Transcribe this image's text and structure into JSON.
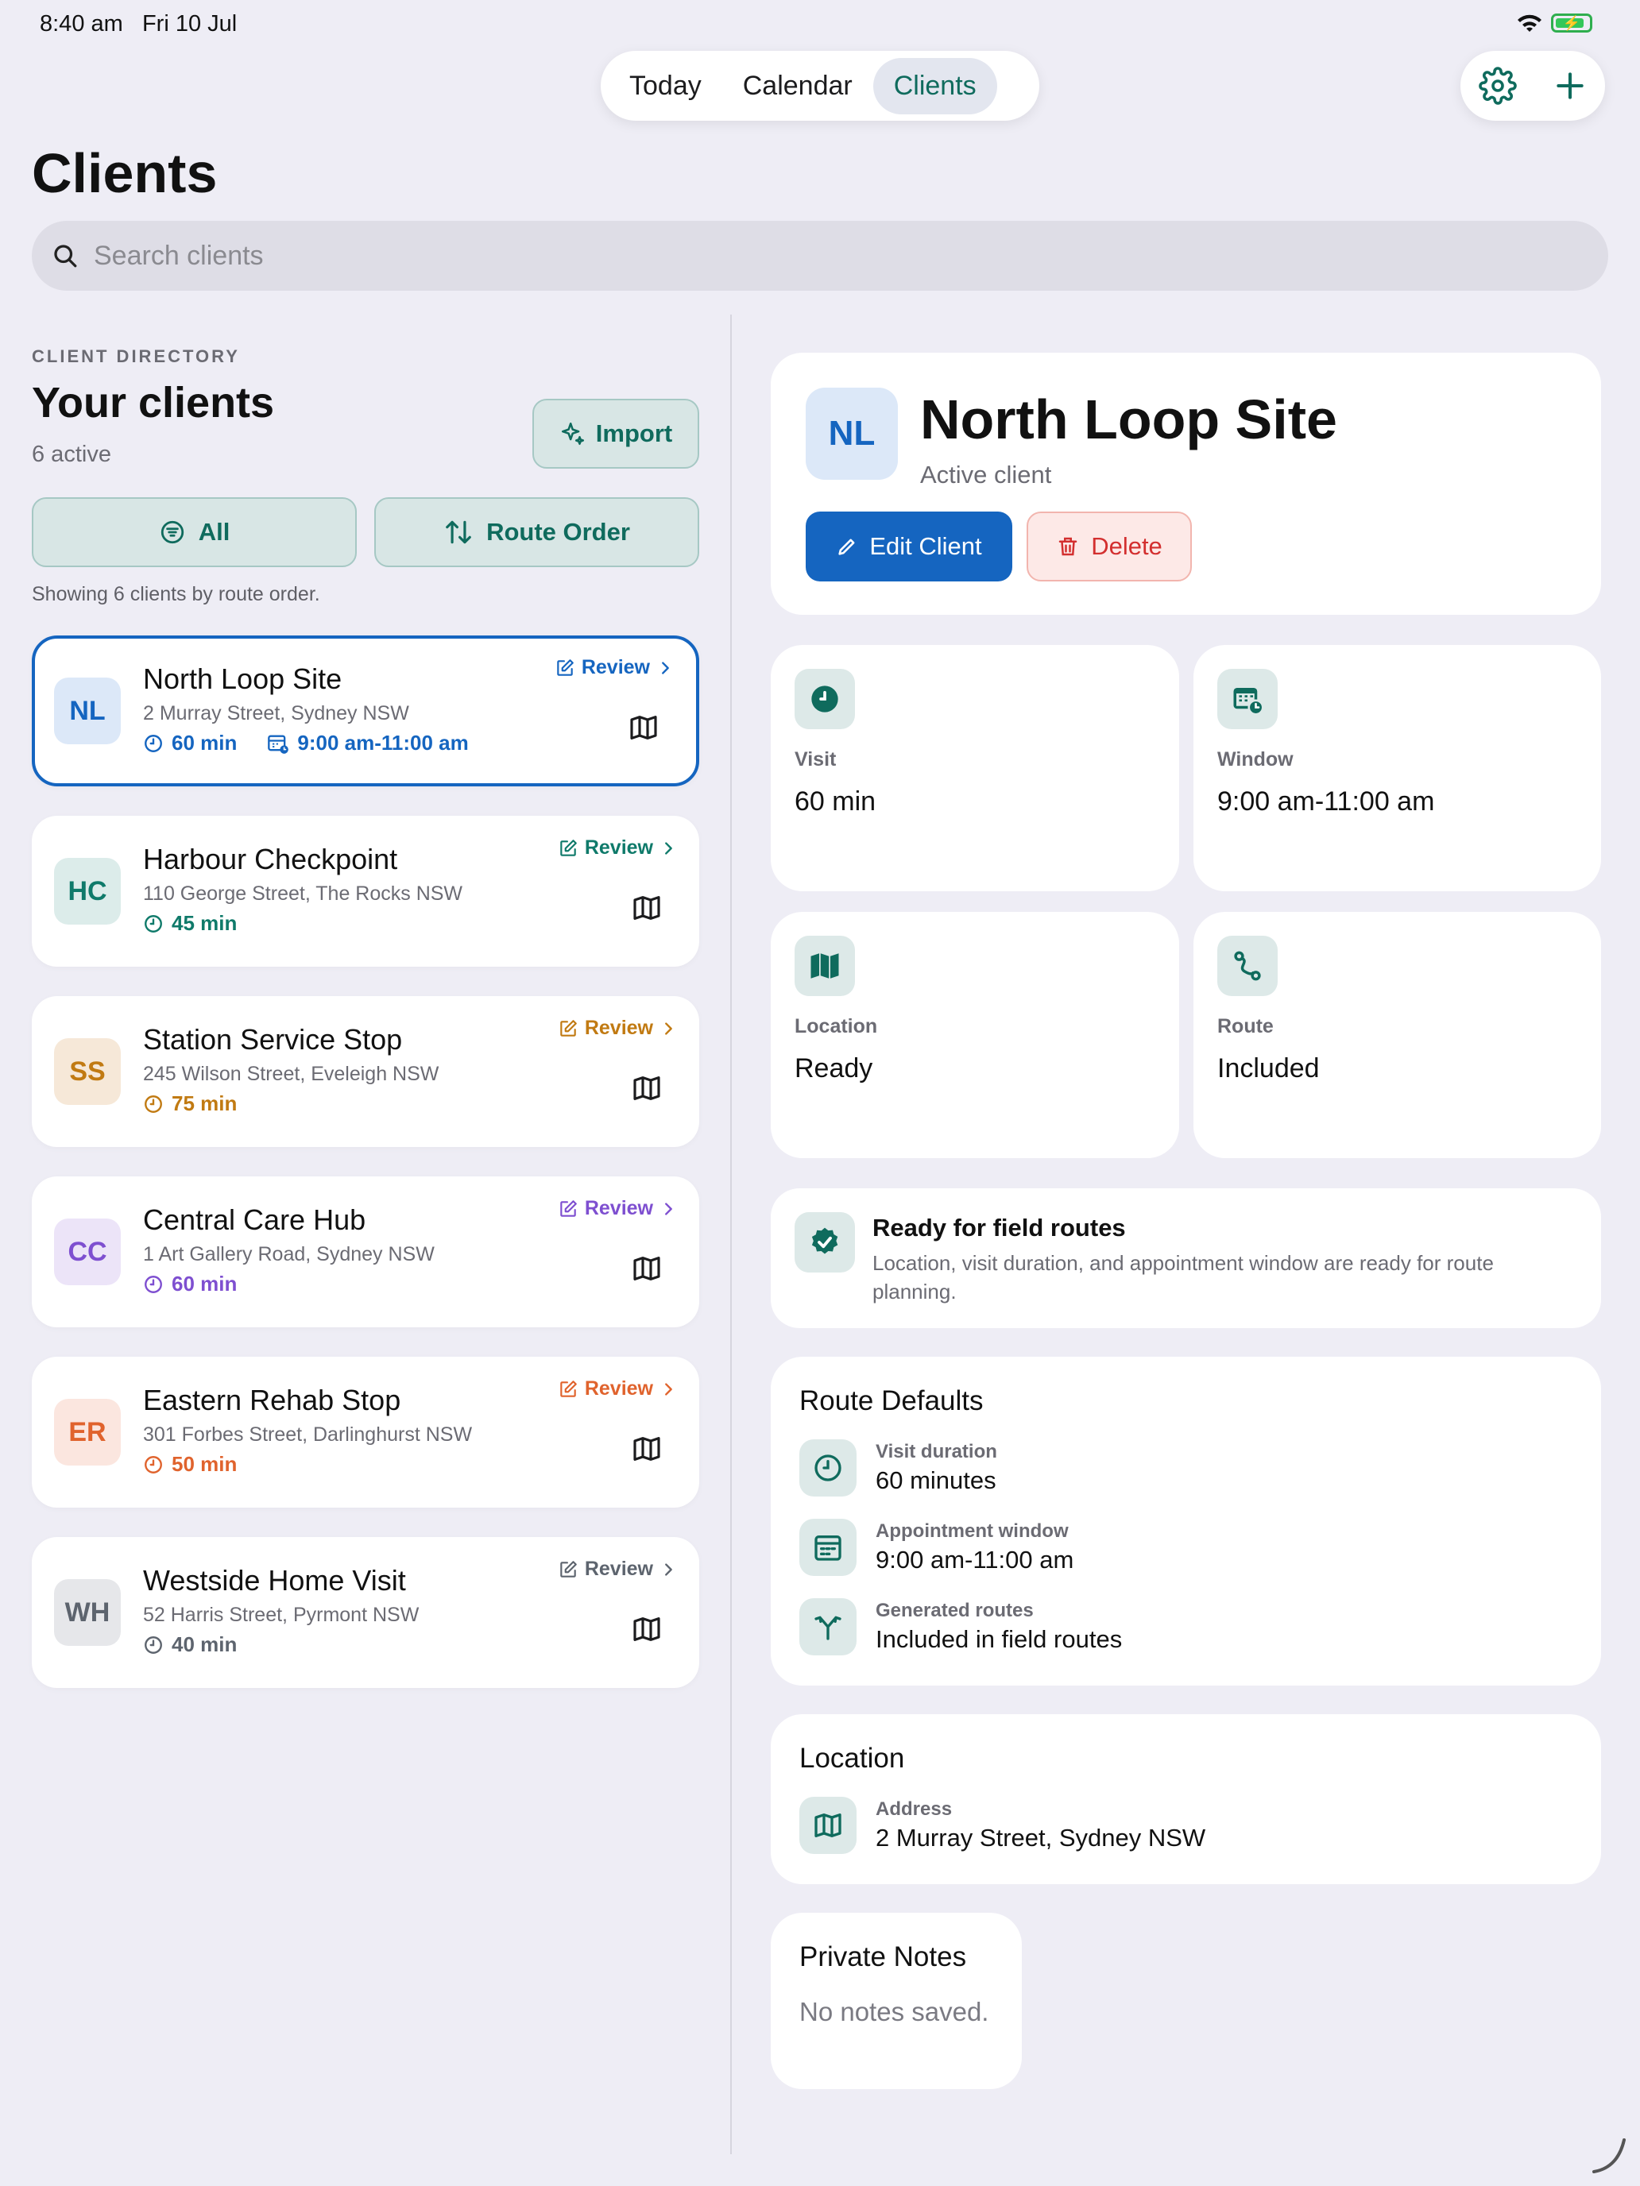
{
  "status_bar": {
    "time": "8:40 am",
    "date": "Fri 10 Jul"
  },
  "nav": {
    "tabs": [
      {
        "label": "Today"
      },
      {
        "label": "Calendar"
      },
      {
        "label": "Clients"
      }
    ],
    "active_tab": "Clients"
  },
  "page_title": "Clients",
  "search": {
    "placeholder": "Search clients",
    "value": ""
  },
  "directory": {
    "eyebrow": "CLIENT DIRECTORY",
    "title": "Your clients",
    "count": "6 active",
    "import_label": "Import",
    "filter_all": "All",
    "filter_route": "Route Order",
    "showing": "Showing 6 clients by route order."
  },
  "clients": [
    {
      "initials": "NL",
      "name": "North Loop Site",
      "address": "2 Murray Street, Sydney NSW",
      "duration": "60 min",
      "window": "9:00 am-11:00 am",
      "review": "Review",
      "color": "#1565c0",
      "bg": "#dce8f8",
      "selected": true
    },
    {
      "initials": "HC",
      "name": "Harbour Checkpoint",
      "address": "110 George Street, The Rocks NSW",
      "duration": "45 min",
      "review": "Review",
      "color": "#0f7a6a",
      "bg": "#dcecea"
    },
    {
      "initials": "SS",
      "name": "Station Service Stop",
      "address": "245 Wilson Street, Eveleigh NSW",
      "duration": "75 min",
      "review": "Review",
      "color": "#c17a12",
      "bg": "#f6e8d8"
    },
    {
      "initials": "CC",
      "name": "Central Care Hub",
      "address": "1 Art Gallery Road, Sydney NSW",
      "duration": "60 min",
      "review": "Review",
      "color": "#7e4fd0",
      "bg": "#ece4f8"
    },
    {
      "initials": "ER",
      "name": "Eastern Rehab Stop",
      "address": "301 Forbes Street, Darlinghurst NSW",
      "duration": "50 min",
      "review": "Review",
      "color": "#e0632d",
      "bg": "#fbe6df"
    },
    {
      "initials": "WH",
      "name": "Westside Home Visit",
      "address": "52 Harris Street, Pyrmont NSW",
      "duration": "40 min",
      "review": "Review",
      "color": "#5d646e",
      "bg": "#e6e7ea"
    }
  ],
  "detail": {
    "initials": "NL",
    "name": "North Loop Site",
    "status": "Active client",
    "edit_label": "Edit Client",
    "delete_label": "Delete",
    "stats": [
      {
        "label": "Visit",
        "value": "60 min",
        "icon": "clock-icon"
      },
      {
        "label": "Window",
        "value": "9:00 am-11:00 am",
        "icon": "calendar-clock-icon"
      },
      {
        "label": "Location",
        "value": "Ready",
        "icon": "map-icon"
      },
      {
        "label": "Route",
        "value": "Included",
        "icon": "route-icon"
      }
    ],
    "ready_title": "Ready for field routes",
    "ready_desc": "Location, visit duration, and appointment window are ready for route planning.",
    "route_defaults": {
      "title": "Route Defaults",
      "rows": [
        {
          "label": "Visit duration",
          "value": "60 minutes",
          "icon": "clock-icon"
        },
        {
          "label": "Appointment window",
          "value": "9:00 am-11:00 am",
          "icon": "calendar-icon"
        },
        {
          "label": "Generated routes",
          "value": "Included in field routes",
          "icon": "merge-arrows-icon"
        }
      ]
    },
    "location": {
      "title": "Location",
      "label": "Address",
      "value": "2 Murray Street, Sydney NSW",
      "icon": "map-icon"
    },
    "notes": {
      "title": "Private Notes",
      "empty": "No notes saved."
    }
  },
  "colors": {
    "accent": "#0f6b5d",
    "primary": "#1565c0",
    "danger": "#d32f2f"
  }
}
